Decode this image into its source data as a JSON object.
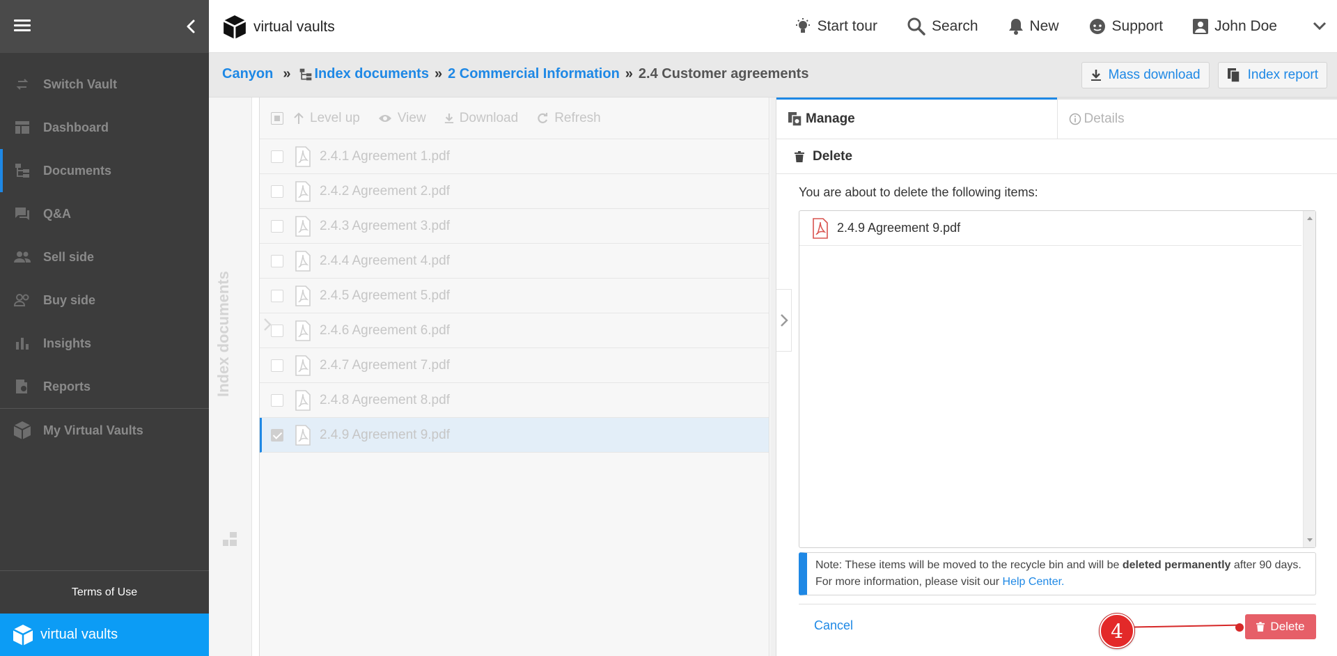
{
  "sidebar": {
    "items": [
      {
        "label": "Switch Vault"
      },
      {
        "label": "Dashboard"
      },
      {
        "label": "Documents"
      },
      {
        "label": "Q&A"
      },
      {
        "label": "Sell side"
      },
      {
        "label": "Buy side"
      },
      {
        "label": "Insights"
      },
      {
        "label": "Reports"
      },
      {
        "label": "My Virtual Vaults"
      }
    ],
    "terms": "Terms of Use",
    "brand": "virtual vaults"
  },
  "header": {
    "logo": "virtual vaults",
    "nav": {
      "tour": "Start tour",
      "search": "Search",
      "new": "New",
      "support": "Support",
      "user": "John Doe"
    }
  },
  "breadcrumb": {
    "root": "Canyon",
    "sep": "»",
    "level1": "Index documents",
    "level2": "2 Commercial Information",
    "current": "2.4 Customer agreements",
    "actions": {
      "mass_download": "Mass download",
      "index_report": "Index report"
    }
  },
  "side_tab": {
    "label": "Index documents"
  },
  "toolbar": {
    "level_up": "Level up",
    "view": "View",
    "download": "Download",
    "refresh": "Refresh"
  },
  "files": [
    {
      "name": "2.4.1 Agreement 1.pdf"
    },
    {
      "name": "2.4.2 Agreement 2.pdf"
    },
    {
      "name": "2.4.3 Agreement 3.pdf"
    },
    {
      "name": "2.4.4 Agreement 4.pdf"
    },
    {
      "name": "2.4.5 Agreement 5.pdf"
    },
    {
      "name": "2.4.6 Agreement 6.pdf"
    },
    {
      "name": "2.4.7 Agreement 7.pdf"
    },
    {
      "name": "2.4.8 Agreement 8.pdf"
    },
    {
      "name": "2.4.9 Agreement 9.pdf"
    }
  ],
  "panel": {
    "tabs": {
      "manage": "Manage",
      "details": "Details"
    },
    "section": "Delete",
    "intro": "You are about to delete the following items:",
    "items": [
      {
        "name": "2.4.9 Agreement 9.pdf"
      }
    ],
    "note": {
      "prefix": "Note: These items will be moved to the recycle bin and will be ",
      "strong": "deleted permanently",
      "suffix": " after 90 days. For more information, please visit our ",
      "link": "Help Center."
    },
    "cancel": "Cancel",
    "delete": "Delete"
  },
  "annotation": {
    "step": "4"
  },
  "colors": {
    "accent": "#1e88e5",
    "sidebar": "#3c3c3c",
    "brand_bar": "#0c9cf5",
    "danger": "#e65f68",
    "step_badge": "#e32929"
  }
}
